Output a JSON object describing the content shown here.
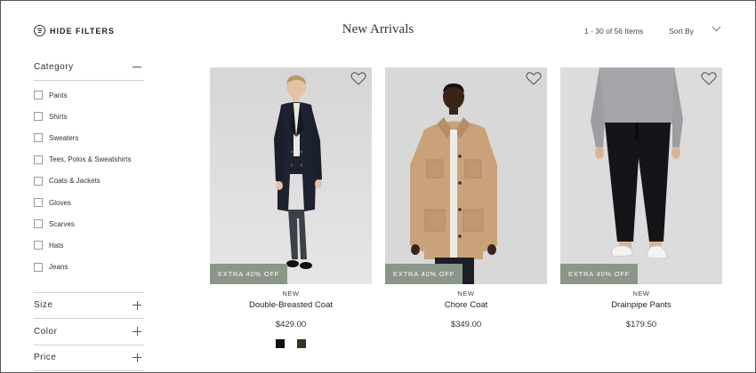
{
  "header": {
    "hide_filters_label": "HIDE FILTERS",
    "filter_icon": "filter-lines-icon",
    "title": "New Arrivals",
    "item_count": "1 - 30 of 56 Items",
    "sort_label": "Sort By",
    "sort_icon": "chevron-down-icon"
  },
  "sidebar": {
    "category": {
      "label": "Category",
      "state_icon": "minus-icon",
      "items": [
        {
          "label": "Pants"
        },
        {
          "label": "Shirts"
        },
        {
          "label": "Sweaters"
        },
        {
          "label": "Tees, Polos & Sweatshirts"
        },
        {
          "label": "Coats & Jackets"
        },
        {
          "label": "Gloves"
        },
        {
          "label": "Scarves"
        },
        {
          "label": "Hats"
        },
        {
          "label": "Jeans"
        }
      ]
    },
    "sections": [
      {
        "label": "Size",
        "state_icon": "plus-icon"
      },
      {
        "label": "Color",
        "state_icon": "plus-icon"
      },
      {
        "label": "Price",
        "state_icon": "plus-icon"
      }
    ]
  },
  "products": [
    {
      "badge": "EXTRA 40% OFF",
      "tag": "NEW",
      "name": "Double-Breasted Coat",
      "price": "$429.00",
      "swatches": [
        "#111111",
        "#3a3226"
      ],
      "wishlist_icon": "heart-icon"
    },
    {
      "badge": "EXTRA 40% OFF",
      "tag": "NEW",
      "name": "Chore Coat",
      "price": "$349.00",
      "swatches": [],
      "wishlist_icon": "heart-icon"
    },
    {
      "badge": "EXTRA 40% OFF",
      "tag": "NEW",
      "name": "Drainpipe Pants",
      "price": "$179.50",
      "swatches": [],
      "wishlist_icon": "heart-icon"
    }
  ],
  "colors": {
    "badge_bg": "#8a9687",
    "photo_bg": "#dadada",
    "divider": "#cfcfcf"
  }
}
